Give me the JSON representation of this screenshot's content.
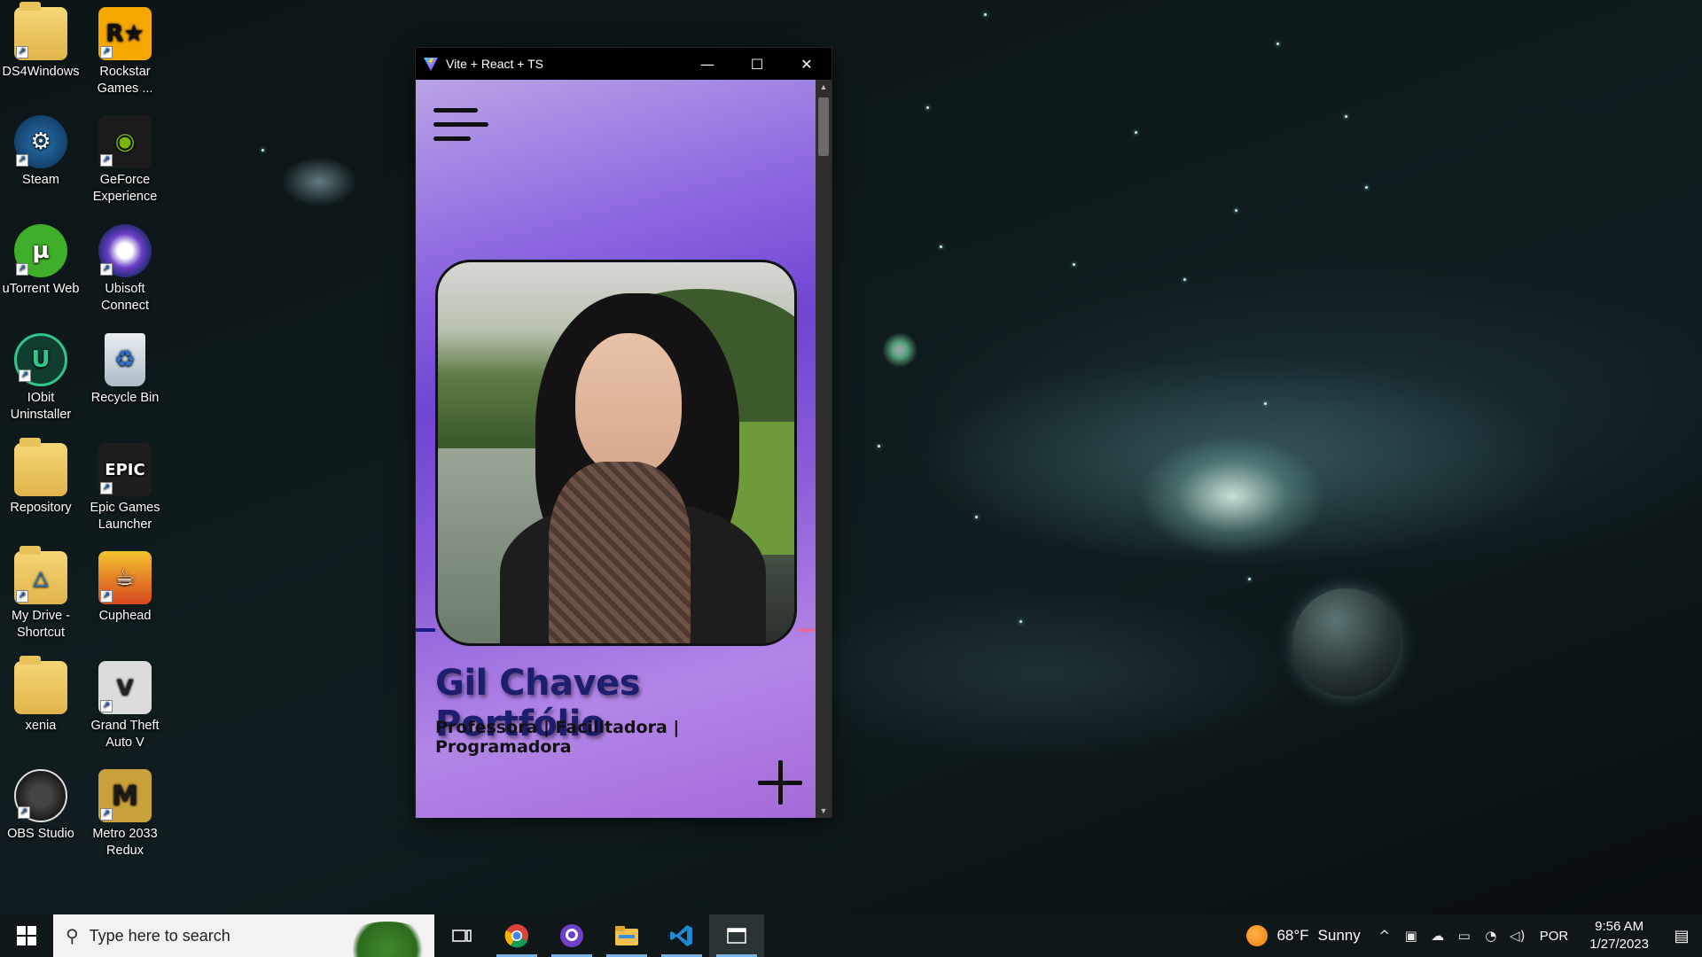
{
  "desktop": {
    "icons": [
      {
        "label": "DS4Windows"
      },
      {
        "label": "Rockstar Games ..."
      },
      {
        "label": "Steam"
      },
      {
        "label": "GeForce Experience"
      },
      {
        "label": "uTorrent Web"
      },
      {
        "label": "Ubisoft Connect"
      },
      {
        "label": "IObit Uninstaller"
      },
      {
        "label": "Recycle Bin"
      },
      {
        "label": "Repository"
      },
      {
        "label": "Epic Games Launcher"
      },
      {
        "label": "My Drive - Shortcut"
      },
      {
        "label": "Cuphead"
      },
      {
        "label": "xenia"
      },
      {
        "label": "Grand Theft Auto V"
      },
      {
        "label": "OBS Studio"
      },
      {
        "label": "Metro 2033 Redux"
      }
    ]
  },
  "window": {
    "title": "Vite + React + TS",
    "minimize_glyph": "—",
    "maximize_glyph": "☐",
    "close_glyph": "✕"
  },
  "page": {
    "title": "Gil Chaves Portfólio",
    "subtitle": "Professora | Facilitadora | Programadora",
    "colors": {
      "title": "#1e1e6e",
      "accent_left": "#1c1d8c",
      "accent_right": "#e26aa6"
    }
  },
  "taskbar": {
    "search_placeholder": "Type here to search",
    "weather_temp": "68°F",
    "weather_desc": "Sunny",
    "language": "POR",
    "time": "9:56 AM",
    "date": "1/27/2023",
    "pinned": [
      "task-view-icon",
      "chrome-icon",
      "github-desktop-icon",
      "file-explorer-icon",
      "vscode-icon",
      "app-window-icon"
    ]
  }
}
